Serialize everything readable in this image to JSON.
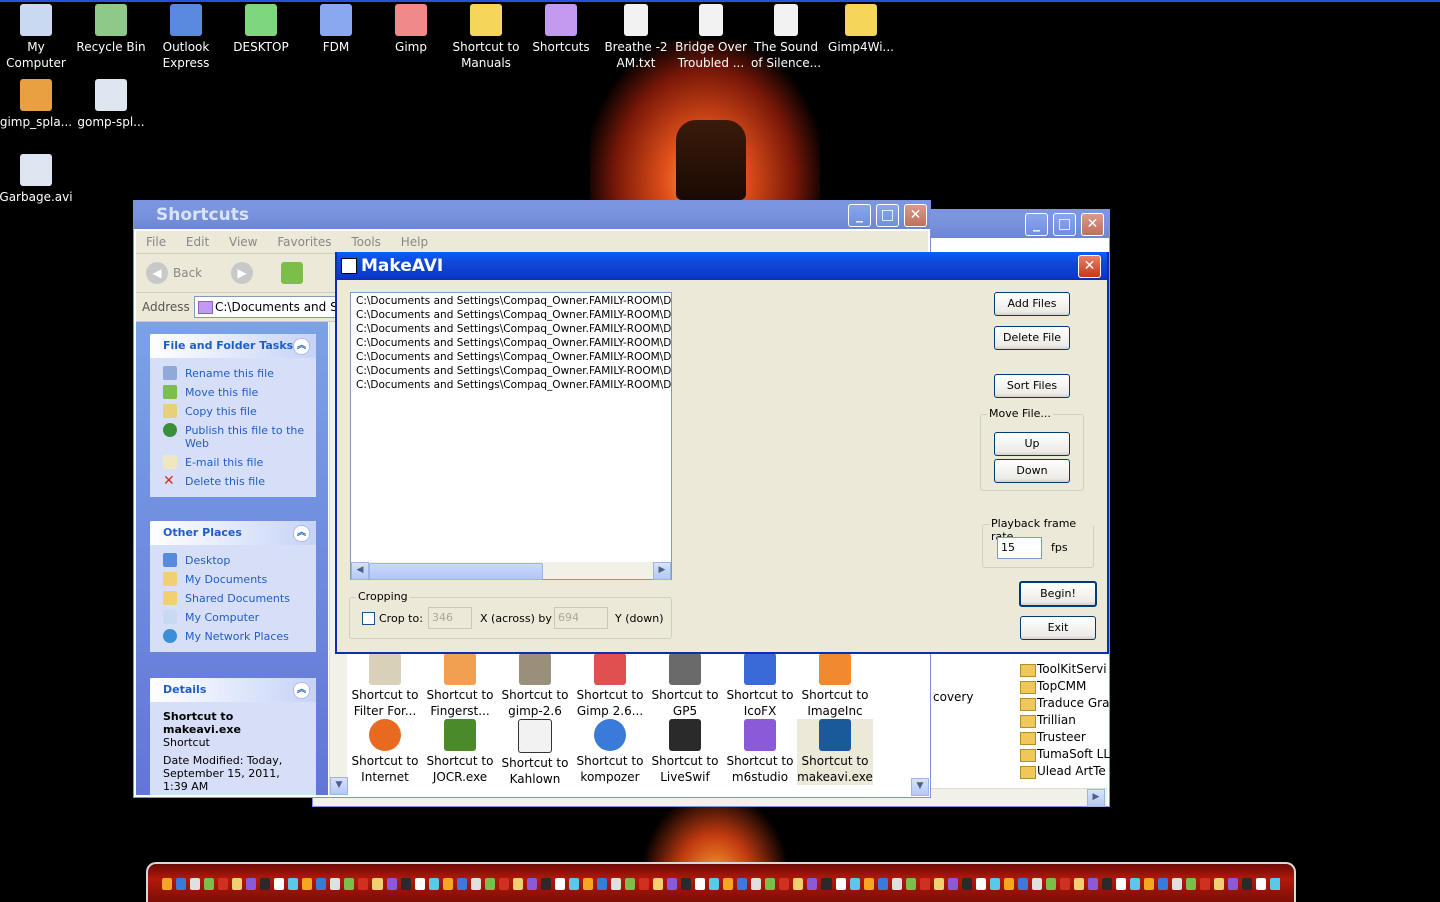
{
  "desktop": {
    "icons": [
      {
        "label": "My Computer",
        "color": "#c9d9f2"
      },
      {
        "label": "Recycle Bin",
        "color": "#8fc98a"
      },
      {
        "label": "Outlook Express",
        "color": "#5a8ae0"
      },
      {
        "label": "DESKTOP",
        "color": "#7ed67e"
      },
      {
        "label": "FDM",
        "color": "#8aa8f0"
      },
      {
        "label": "Gimp",
        "color": "#f08a8a"
      },
      {
        "label": "Shortcut to Manuals",
        "color": "#f6d65a"
      },
      {
        "label": "Shortcuts",
        "color": "#c29af0"
      },
      {
        "label": "Breathe -2 AM.txt",
        "color": "#f2f2f2"
      },
      {
        "label": "Bridge Over Troubled ...",
        "color": "#f2f2f2"
      },
      {
        "label": "The Sound of Silence...",
        "color": "#f2f2f2"
      },
      {
        "label": "Gimp4Wi...",
        "color": "#f6d65a"
      },
      {
        "label": "gimp_spla...",
        "color": "#e9a040"
      },
      {
        "label": "gomp-spl...",
        "color": "#dfe6f2"
      },
      {
        "label": "Garbage.avi",
        "color": "#dfe6f2"
      }
    ]
  },
  "explorer": {
    "title": "Shortcuts",
    "menu": [
      "File",
      "Edit",
      "View",
      "Favorites",
      "Tools",
      "Help"
    ],
    "back_label": "Back",
    "address_label": "Address",
    "address_value": "C:\\Documents and Se",
    "file_tasks": {
      "title": "File and Folder Tasks",
      "items": [
        "Rename this file",
        "Move this file",
        "Copy this file",
        "Publish this file to the Web",
        "E-mail this file",
        "Delete this file"
      ]
    },
    "other_places": {
      "title": "Other Places",
      "items": [
        "Desktop",
        "My Documents",
        "Shared Documents",
        "My Computer",
        "My Network Places"
      ]
    },
    "details": {
      "title": "Details",
      "name": "Shortcut to makeavi.exe",
      "type": "Shortcut",
      "modified": "Date Modified: Today, September 15, 2011, 1:39 AM"
    },
    "files_row1": [
      "Shortcut to Filter For...",
      "Shortcut to Fingerst...",
      "Shortcut to gimp-2.6",
      "Shortcut to Gimp 2.6...",
      "Shortcut to GP5",
      "Shortcut to IcoFX",
      "Shortcut to ImageInc"
    ],
    "files_row2": [
      "Shortcut to Internet",
      "Shortcut to JOCR.exe",
      "Shortcut to Kahlown",
      "Shortcut to kompozer",
      "Shortcut to LiveSwif",
      "Shortcut to m6studio",
      "Shortcut to makeavi.exe"
    ]
  },
  "back_window": {
    "partial_text": "covery",
    "folders": [
      "ToolKitServi",
      "TopCMM",
      "Traduce Gra",
      "Trillian",
      "Trusteer",
      "TumaSoft LL",
      "Ulead ArtTe"
    ]
  },
  "makeavi": {
    "title": "MakeAVI",
    "files": [
      "C:\\Documents and Settings\\Compaq_Owner.FAMILY-ROOM\\Desl",
      "C:\\Documents and Settings\\Compaq_Owner.FAMILY-ROOM\\Desl",
      "C:\\Documents and Settings\\Compaq_Owner.FAMILY-ROOM\\Desl",
      "C:\\Documents and Settings\\Compaq_Owner.FAMILY-ROOM\\Desl",
      "C:\\Documents and Settings\\Compaq_Owner.FAMILY-ROOM\\Desl",
      "C:\\Documents and Settings\\Compaq_Owner.FAMILY-ROOM\\Desl",
      "C:\\Documents and Settings\\Compaq_Owner.FAMILY-ROOM\\Desl"
    ],
    "add_files": "Add Files",
    "delete_file": "Delete File",
    "sort_files": "Sort Files",
    "move_file_label": "Move File...",
    "up": "Up",
    "down": "Down",
    "frame_rate_label": "Playback frame rate",
    "frame_rate_value": "15",
    "fps_label": "fps",
    "begin": "Begin!",
    "exit": "Exit",
    "cropping_label": "Cropping",
    "crop_to_label": "Crop to:",
    "crop_x": "346",
    "across_label": "X (across) by",
    "crop_y": "694",
    "down_label": "Y (down)"
  }
}
